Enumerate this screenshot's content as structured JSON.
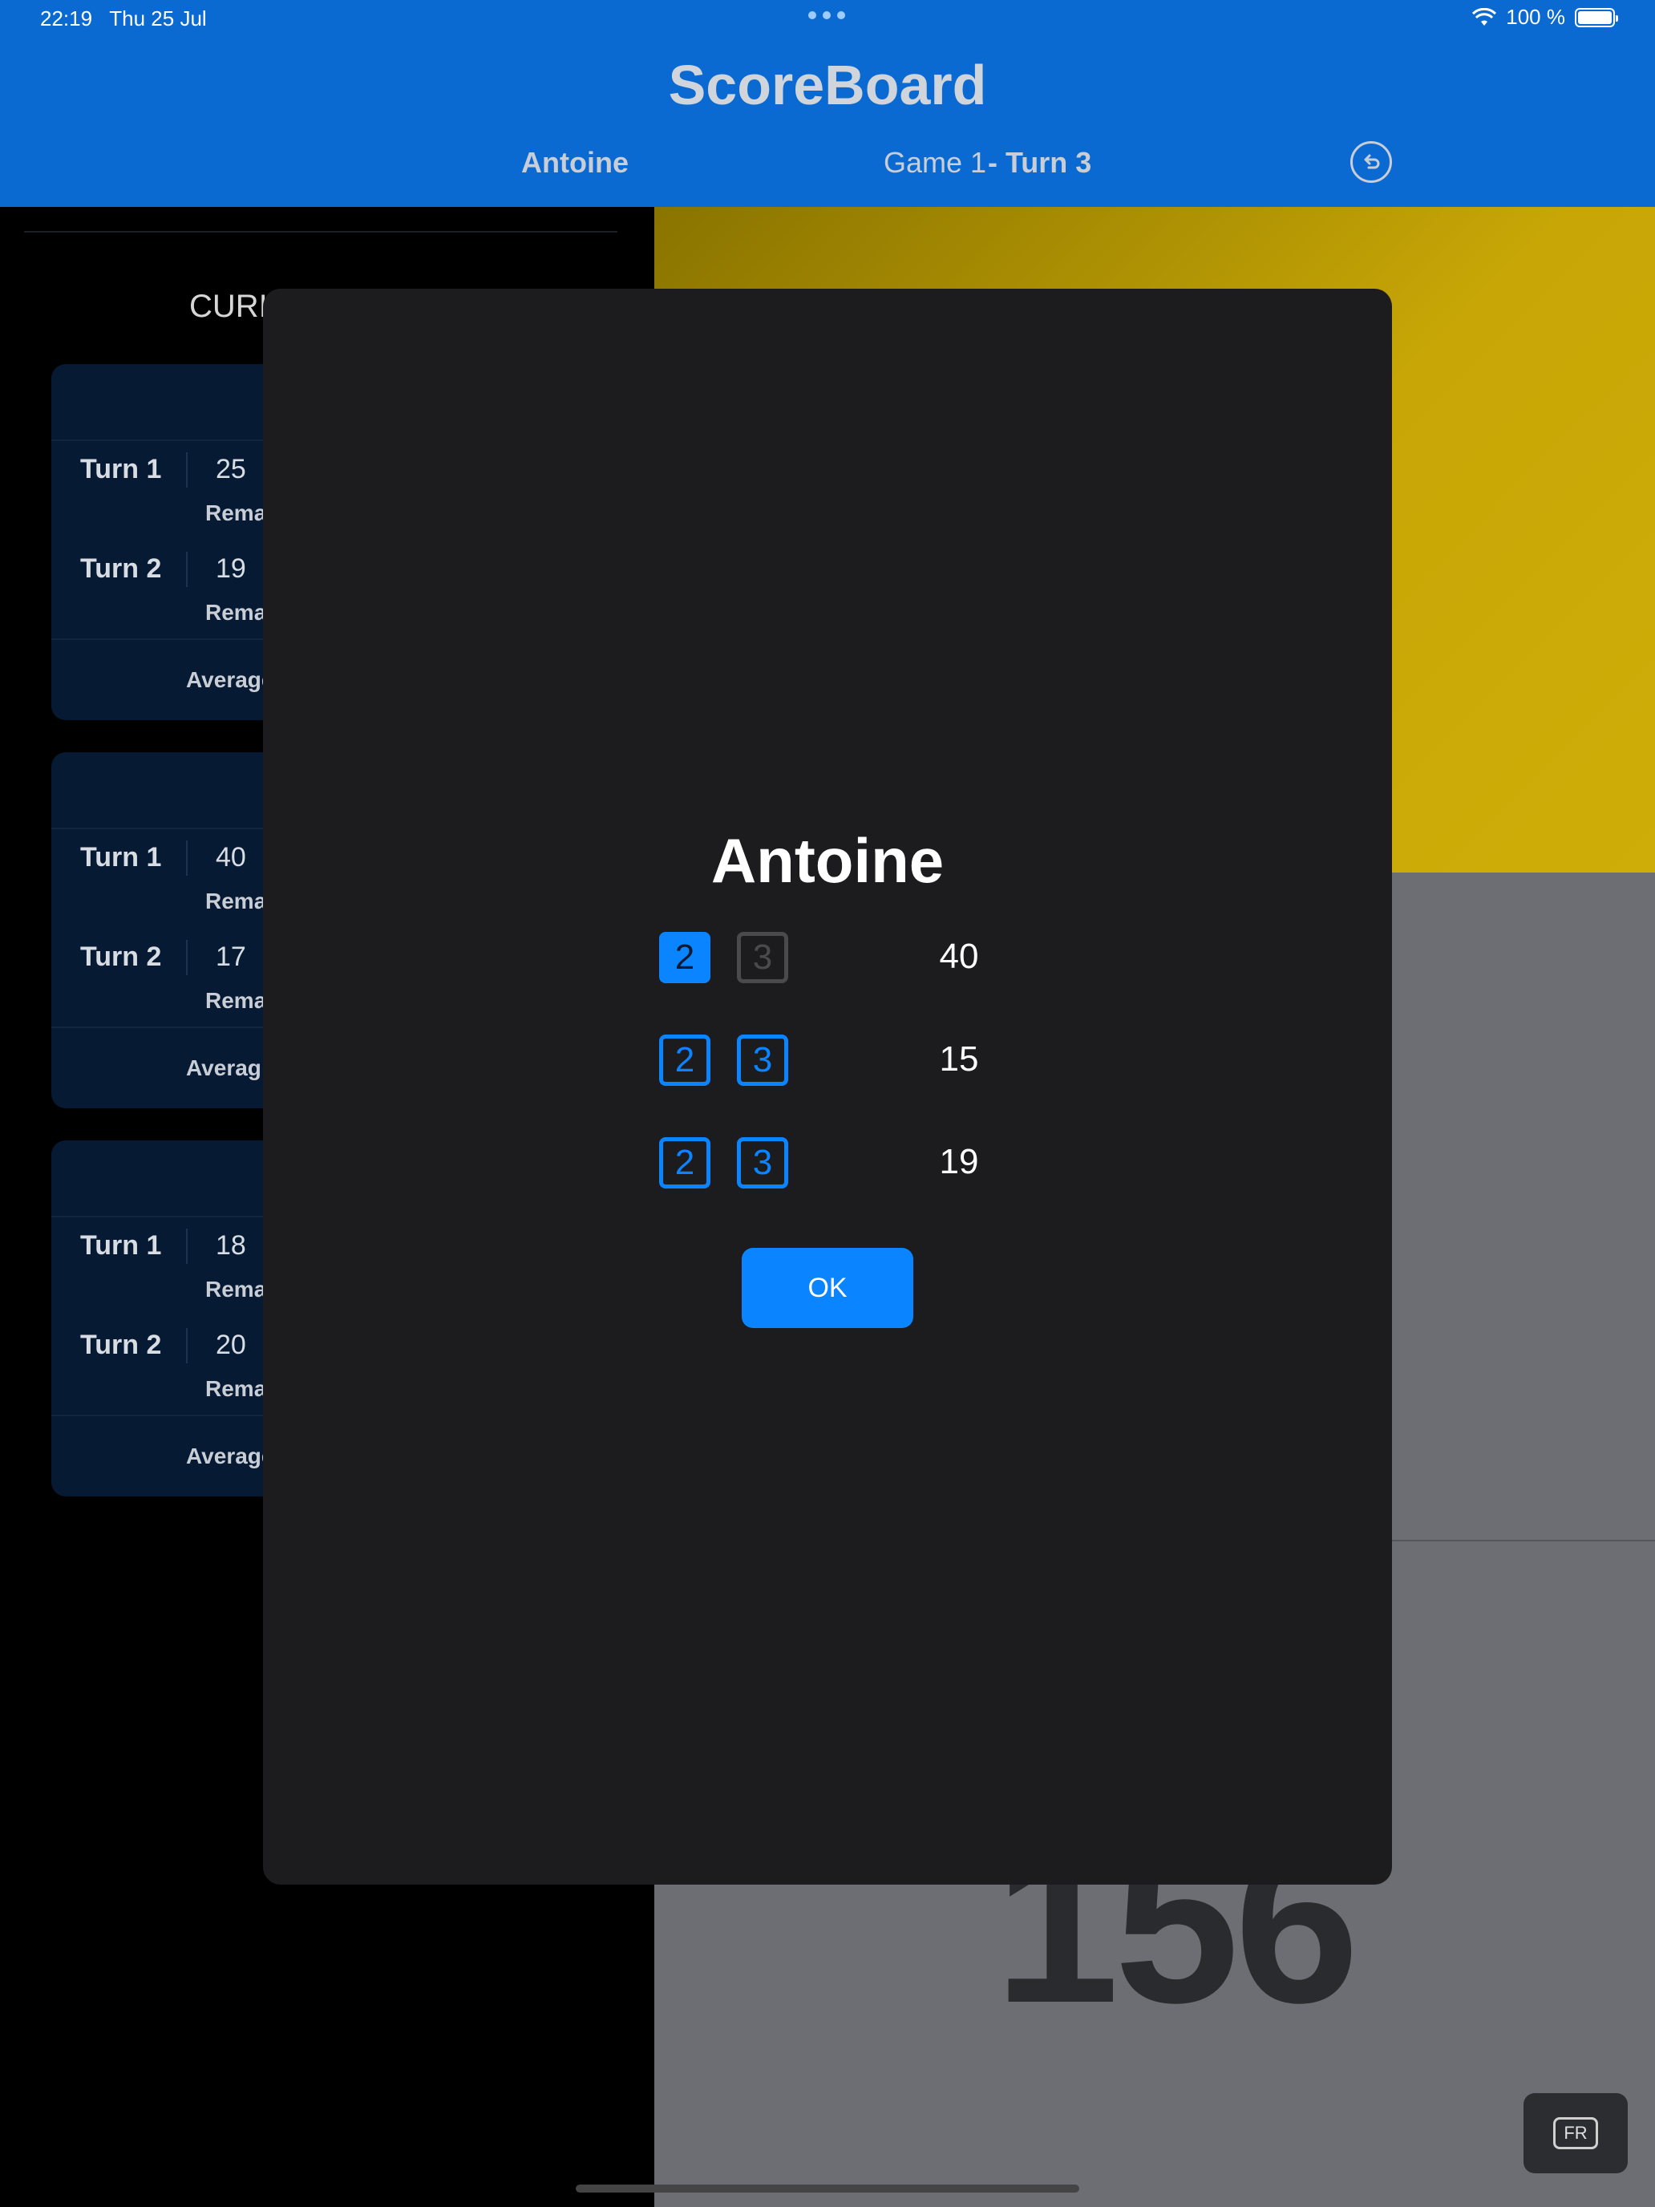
{
  "status_bar": {
    "time": "22:19",
    "date": "Thu 25 Jul",
    "battery": "100 %"
  },
  "header": {
    "title": "ScoreBoard",
    "player": "Antoine",
    "game": "Game 1",
    "turn": "- Turn 3",
    "undo_icon": "undo-icon"
  },
  "left_panel": {
    "title_partial": "CURI",
    "cards": [
      {
        "rows": [
          {
            "turn": "Turn 1",
            "score": "25",
            "remaining": "Rema"
          },
          {
            "turn": "Turn 2",
            "score": "19",
            "remaining": "Rema"
          }
        ],
        "average": "Average"
      },
      {
        "rows": [
          {
            "turn": "Turn 1",
            "score": "40",
            "remaining": "Rema"
          },
          {
            "turn": "Turn 2",
            "score": "17",
            "remaining": "Rema"
          }
        ],
        "average": "Averag"
      },
      {
        "rows": [
          {
            "turn": "Turn 1",
            "score": "18",
            "remaining": "Rema"
          },
          {
            "turn": "Turn 2",
            "score": "20",
            "remaining": "Rema"
          }
        ],
        "average": "Average"
      }
    ]
  },
  "right_panel": {
    "big_score": "156",
    "language_button": "FR"
  },
  "modal": {
    "player": "Antoine",
    "darts": [
      {
        "opt_a": "2",
        "opt_b": "3",
        "score": "40",
        "state": "a-selected"
      },
      {
        "opt_a": "2",
        "opt_b": "3",
        "score": "15",
        "state": "none"
      },
      {
        "opt_a": "2",
        "opt_b": "3",
        "score": "19",
        "state": "none"
      }
    ],
    "ok_label": "OK"
  },
  "colors": {
    "header_bg": "#0A6AD2",
    "accent": "#0A84FF",
    "modal_bg": "#1C1C1E",
    "yellow_panel": "#C7A606",
    "grey_panel": "#6D6E73",
    "card_bg": "#071A33"
  }
}
